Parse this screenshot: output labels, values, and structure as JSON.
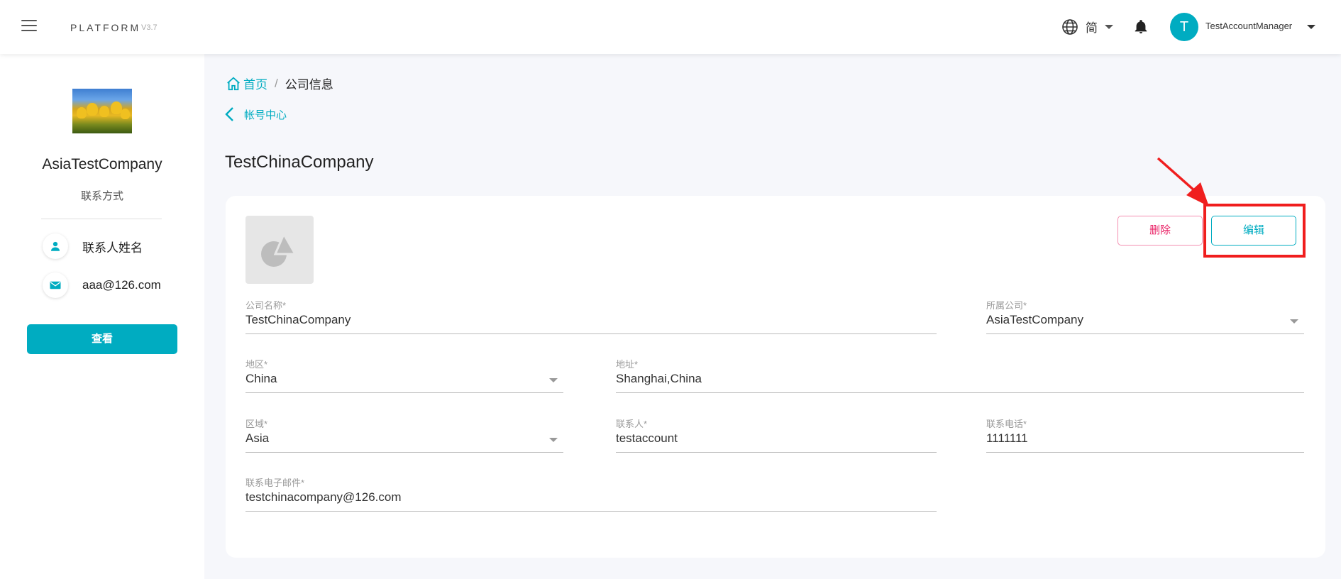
{
  "header": {
    "brand": "PLATFORM",
    "version": "V3.7",
    "language": "简",
    "avatar_initial": "T",
    "username": "TestAccountManager"
  },
  "sidebar": {
    "company_name": "AsiaTestCompany",
    "contact_link": "联系方式",
    "contact_name": "联系人姓名",
    "contact_email": "aaa@126.com",
    "view_button": "查看"
  },
  "breadcrumb": {
    "home": "首页",
    "separator": "/",
    "current": "公司信息"
  },
  "back_link": "帐号中心",
  "page_title": "TestChinaCompany",
  "actions": {
    "delete": "删除",
    "edit": "编辑"
  },
  "form": {
    "company_name": {
      "label": "公司名称*",
      "value": "TestChinaCompany"
    },
    "parent_company": {
      "label": "所属公司*",
      "value": "AsiaTestCompany"
    },
    "region": {
      "label": "地区*",
      "value": "China"
    },
    "address": {
      "label": "地址*",
      "value": "Shanghai,China"
    },
    "area": {
      "label": "区域*",
      "value": "Asia"
    },
    "contact": {
      "label": "联系人*",
      "value": "testaccount"
    },
    "phone": {
      "label": "联系电话*",
      "value": "1111111"
    },
    "email": {
      "label": "联系电子邮件*",
      "value": "testchinacompany@126.com"
    }
  },
  "colors": {
    "accent": "#00acc1",
    "danger": "#e91e63",
    "annotation": "#f01e1e"
  }
}
